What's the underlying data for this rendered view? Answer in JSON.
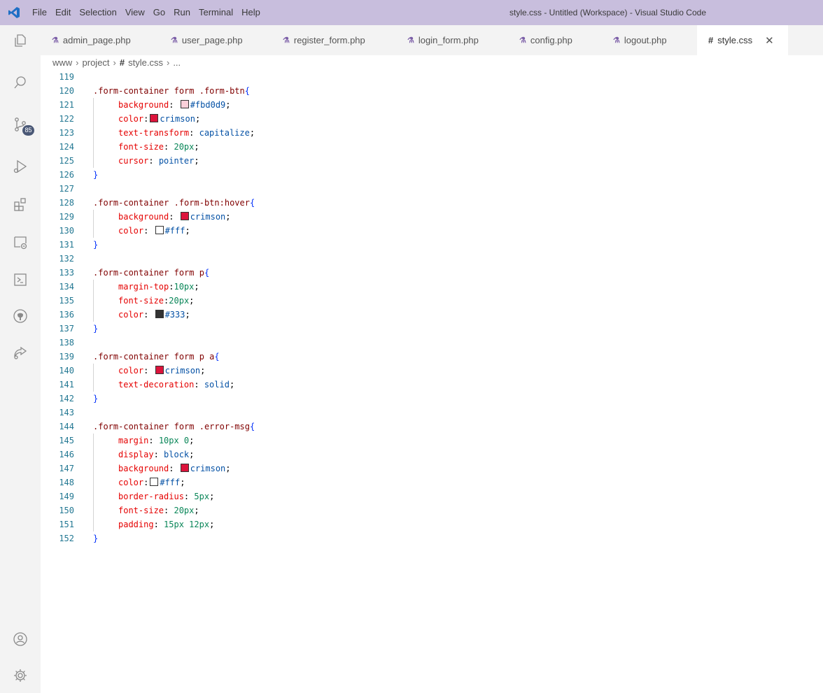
{
  "window": {
    "title": "style.css - Untitled (Workspace) - Visual Studio Code",
    "menu": [
      "File",
      "Edit",
      "Selection",
      "View",
      "Go",
      "Run",
      "Terminal",
      "Help"
    ]
  },
  "activity_bar": {
    "source_control_badge": "85",
    "icons": [
      "explorer-icon",
      "search-icon",
      "source-control-icon",
      "run-debug-icon",
      "extensions-icon",
      "remote-explorer-icon",
      "terminal-icon",
      "github-icon",
      "live-share-icon",
      "accounts-icon",
      "settings-gear-icon"
    ]
  },
  "tabs": [
    {
      "label": "admin_page.php",
      "icon": "php-icon",
      "active": false
    },
    {
      "label": "user_page.php",
      "icon": "php-icon",
      "active": false
    },
    {
      "label": "register_form.php",
      "icon": "php-icon",
      "active": false
    },
    {
      "label": "login_form.php",
      "icon": "php-icon",
      "active": false
    },
    {
      "label": "config.php",
      "icon": "php-icon",
      "active": false
    },
    {
      "label": "logout.php",
      "icon": "php-icon",
      "active": false
    },
    {
      "label": "style.css",
      "icon": "css-icon",
      "active": true
    }
  ],
  "breadcrumb": [
    "www",
    "project",
    "style.css",
    "..."
  ],
  "colors": {
    "titlebar": "#c8bedd",
    "crimson": "#dc143c",
    "pink": "#fbd0d9",
    "white": "#ffffff",
    "dark": "#333333"
  },
  "code": {
    "lines": [
      {
        "n": "119",
        "indent": 0,
        "tokens": []
      },
      {
        "n": "120",
        "indent": 0,
        "tokens": [
          [
            "sel",
            ".form-container form .form-btn"
          ],
          [
            "brace",
            "{"
          ]
        ]
      },
      {
        "n": "121",
        "indent": 1,
        "tokens": [
          [
            "prop",
            "background"
          ],
          [
            "pun",
            ": "
          ],
          [
            "swatch",
            "#fbd0d9"
          ],
          [
            "val",
            "#fbd0d9"
          ],
          [
            "pun",
            ";"
          ]
        ]
      },
      {
        "n": "122",
        "indent": 1,
        "tokens": [
          [
            "prop",
            "color"
          ],
          [
            "pun",
            ":"
          ],
          [
            "swatch",
            "#dc143c"
          ],
          [
            "val",
            "crimson"
          ],
          [
            "pun",
            ";"
          ]
        ]
      },
      {
        "n": "123",
        "indent": 1,
        "tokens": [
          [
            "prop",
            "text-transform"
          ],
          [
            "pun",
            ": "
          ],
          [
            "val",
            "capitalize"
          ],
          [
            "pun",
            ";"
          ]
        ]
      },
      {
        "n": "124",
        "indent": 1,
        "tokens": [
          [
            "prop",
            "font-size"
          ],
          [
            "pun",
            ": "
          ],
          [
            "num",
            "20px"
          ],
          [
            "pun",
            ";"
          ]
        ]
      },
      {
        "n": "125",
        "indent": 1,
        "tokens": [
          [
            "prop",
            "cursor"
          ],
          [
            "pun",
            ": "
          ],
          [
            "val",
            "pointer"
          ],
          [
            "pun",
            ";"
          ]
        ]
      },
      {
        "n": "126",
        "indent": 0,
        "tokens": [
          [
            "brace",
            "}"
          ]
        ]
      },
      {
        "n": "127",
        "indent": 0,
        "tokens": []
      },
      {
        "n": "128",
        "indent": 0,
        "tokens": [
          [
            "sel",
            ".form-container .form-btn:hover"
          ],
          [
            "brace",
            "{"
          ]
        ]
      },
      {
        "n": "129",
        "indent": 1,
        "tokens": [
          [
            "prop",
            "background"
          ],
          [
            "pun",
            ": "
          ],
          [
            "swatch",
            "#dc143c"
          ],
          [
            "val",
            "crimson"
          ],
          [
            "pun",
            ";"
          ]
        ]
      },
      {
        "n": "130",
        "indent": 1,
        "tokens": [
          [
            "prop",
            "color"
          ],
          [
            "pun",
            ": "
          ],
          [
            "swatch",
            "#ffffff"
          ],
          [
            "val",
            "#fff"
          ],
          [
            "pun",
            ";"
          ]
        ]
      },
      {
        "n": "131",
        "indent": 0,
        "tokens": [
          [
            "brace",
            "}"
          ]
        ]
      },
      {
        "n": "132",
        "indent": 0,
        "tokens": []
      },
      {
        "n": "133",
        "indent": 0,
        "tokens": [
          [
            "sel",
            ".form-container form p"
          ],
          [
            "brace",
            "{"
          ]
        ]
      },
      {
        "n": "134",
        "indent": 1,
        "tokens": [
          [
            "prop",
            "margin-top"
          ],
          [
            "pun",
            ":"
          ],
          [
            "num",
            "10px"
          ],
          [
            "pun",
            ";"
          ]
        ]
      },
      {
        "n": "135",
        "indent": 1,
        "tokens": [
          [
            "prop",
            "font-size"
          ],
          [
            "pun",
            ":"
          ],
          [
            "num",
            "20px"
          ],
          [
            "pun",
            ";"
          ]
        ]
      },
      {
        "n": "136",
        "indent": 1,
        "tokens": [
          [
            "prop",
            "color"
          ],
          [
            "pun",
            ": "
          ],
          [
            "swatch",
            "#333333"
          ],
          [
            "val",
            "#333"
          ],
          [
            "pun",
            ";"
          ]
        ]
      },
      {
        "n": "137",
        "indent": 0,
        "tokens": [
          [
            "brace",
            "}"
          ]
        ]
      },
      {
        "n": "138",
        "indent": 0,
        "tokens": []
      },
      {
        "n": "139",
        "indent": 0,
        "tokens": [
          [
            "sel",
            ".form-container form p a"
          ],
          [
            "brace",
            "{"
          ]
        ]
      },
      {
        "n": "140",
        "indent": 1,
        "tokens": [
          [
            "prop",
            "color"
          ],
          [
            "pun",
            ": "
          ],
          [
            "swatch",
            "#dc143c"
          ],
          [
            "val",
            "crimson"
          ],
          [
            "pun",
            ";"
          ]
        ]
      },
      {
        "n": "141",
        "indent": 1,
        "tokens": [
          [
            "prop",
            "text-decoration"
          ],
          [
            "pun",
            ": "
          ],
          [
            "val",
            "solid"
          ],
          [
            "pun",
            ";"
          ]
        ]
      },
      {
        "n": "142",
        "indent": 0,
        "tokens": [
          [
            "brace",
            "}"
          ]
        ]
      },
      {
        "n": "143",
        "indent": 0,
        "tokens": []
      },
      {
        "n": "144",
        "indent": 0,
        "tokens": [
          [
            "sel",
            ".form-container form .error-msg"
          ],
          [
            "brace",
            "{"
          ]
        ]
      },
      {
        "n": "145",
        "indent": 1,
        "tokens": [
          [
            "prop",
            "margin"
          ],
          [
            "pun",
            ": "
          ],
          [
            "num",
            "10px 0"
          ],
          [
            "pun",
            ";"
          ]
        ]
      },
      {
        "n": "146",
        "indent": 1,
        "tokens": [
          [
            "prop",
            "display"
          ],
          [
            "pun",
            ": "
          ],
          [
            "val",
            "block"
          ],
          [
            "pun",
            ";"
          ]
        ]
      },
      {
        "n": "147",
        "indent": 1,
        "tokens": [
          [
            "prop",
            "background"
          ],
          [
            "pun",
            ": "
          ],
          [
            "swatch",
            "#dc143c"
          ],
          [
            "val",
            "crimson"
          ],
          [
            "pun",
            ";"
          ]
        ]
      },
      {
        "n": "148",
        "indent": 1,
        "tokens": [
          [
            "prop",
            "color"
          ],
          [
            "pun",
            ":"
          ],
          [
            "swatch",
            "#ffffff"
          ],
          [
            "val",
            "#fff"
          ],
          [
            "pun",
            ";"
          ]
        ]
      },
      {
        "n": "149",
        "indent": 1,
        "tokens": [
          [
            "prop",
            "border-radius"
          ],
          [
            "pun",
            ": "
          ],
          [
            "num",
            "5px"
          ],
          [
            "pun",
            ";"
          ]
        ]
      },
      {
        "n": "150",
        "indent": 1,
        "tokens": [
          [
            "prop",
            "font-size"
          ],
          [
            "pun",
            ": "
          ],
          [
            "num",
            "20px"
          ],
          [
            "pun",
            ";"
          ]
        ]
      },
      {
        "n": "151",
        "indent": 1,
        "tokens": [
          [
            "prop",
            "padding"
          ],
          [
            "pun",
            ": "
          ],
          [
            "num",
            "15px 12px"
          ],
          [
            "pun",
            ";"
          ]
        ]
      },
      {
        "n": "152",
        "indent": 0,
        "tokens": [
          [
            "brace",
            "}"
          ]
        ]
      }
    ]
  }
}
